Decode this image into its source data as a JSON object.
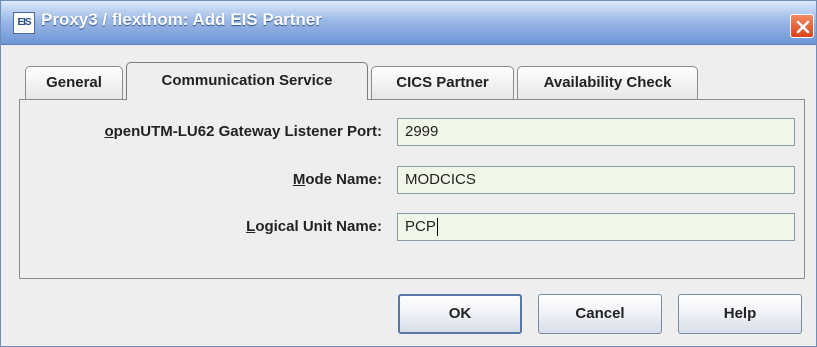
{
  "window": {
    "icon_text": "EIS",
    "title": "Proxy3 / flexthom: Add EIS Partner"
  },
  "tabs": [
    {
      "label": "General",
      "active": false
    },
    {
      "label": "Communication Service",
      "active": true
    },
    {
      "label": "CICS Partner",
      "active": false
    },
    {
      "label": "Availability Check",
      "active": false
    }
  ],
  "form": {
    "listener_port": {
      "label": "openUTM-LU62 Gateway Listener Port:",
      "mnemonic": "o",
      "value": "2999"
    },
    "mode_name": {
      "label": "Mode Name:",
      "mnemonic": "M",
      "value": "MODCICS"
    },
    "logical_unit_name": {
      "label": "Logical Unit Name:",
      "mnemonic": "L",
      "value": "PCP"
    }
  },
  "buttons": {
    "ok": "OK",
    "cancel": "Cancel",
    "help": "Help"
  },
  "colors": {
    "titlebar_start": "#dde9fb",
    "titlebar_end": "#6d95d6",
    "close_button": "#d9431b",
    "input_background": "#f0f7e8",
    "window_background": "#eeeeee"
  }
}
